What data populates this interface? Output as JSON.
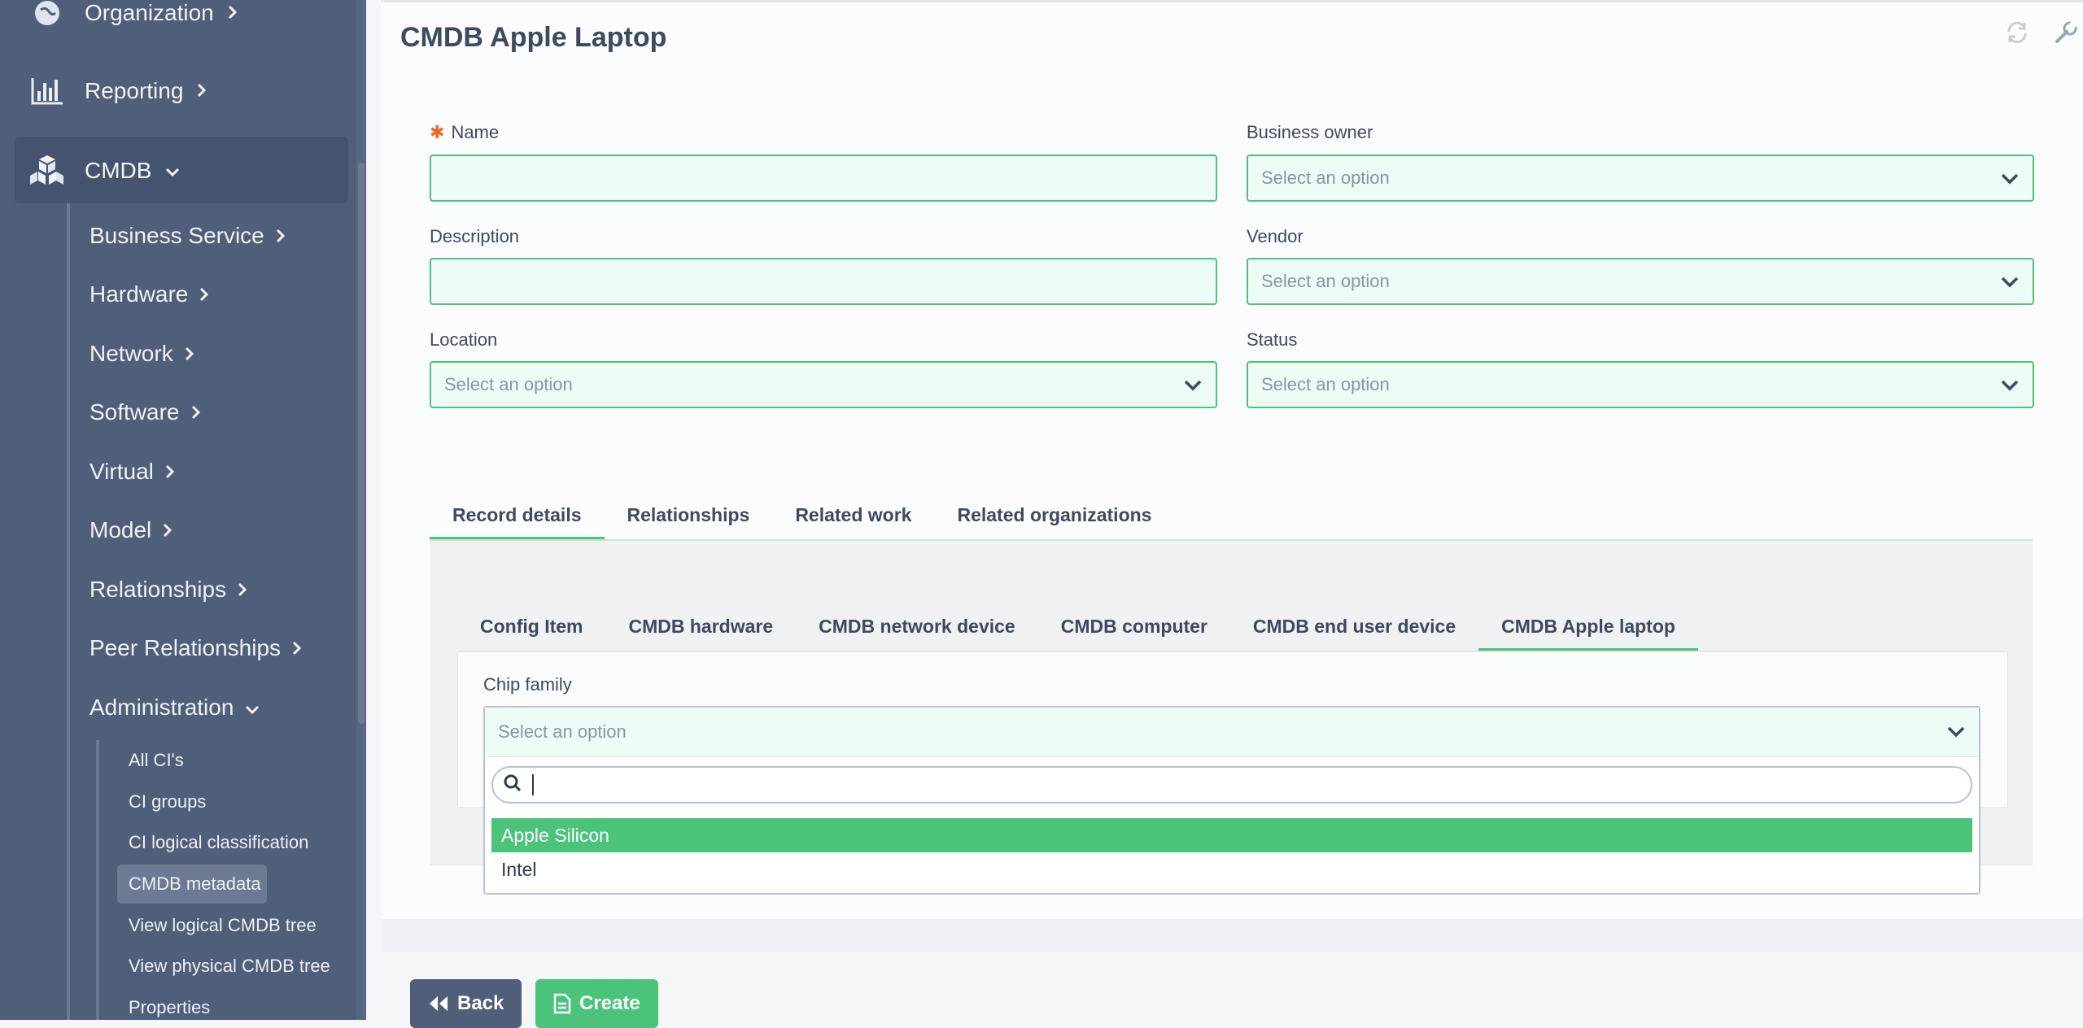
{
  "page": {
    "title": "CMDB Apple Laptop"
  },
  "sidebar": {
    "top": [
      {
        "label": "Organization",
        "icon": "globe-icon"
      },
      {
        "label": "Reporting",
        "icon": "bar-chart-icon"
      },
      {
        "label": "CMDB",
        "icon": "cubes-icon"
      }
    ],
    "cmdb_items": [
      "Business Service",
      "Hardware",
      "Network",
      "Software",
      "Virtual",
      "Model",
      "Relationships",
      "Peer Relationships",
      "Administration"
    ],
    "admin_items": [
      "All CI's",
      "CI groups",
      "CI logical classification",
      "CMDB metadata",
      "View logical CMDB tree",
      "View physical CMDB tree",
      "Properties"
    ],
    "active_admin_item": "CMDB metadata"
  },
  "form": {
    "name_label": "Name",
    "description_label": "Description",
    "location_label": "Location",
    "business_owner_label": "Business owner",
    "vendor_label": "Vendor",
    "status_label": "Status",
    "placeholder": "Select an option"
  },
  "tabs": [
    "Record details",
    "Relationships",
    "Related work",
    "Related organizations"
  ],
  "active_tab": "Record details",
  "subtabs": [
    "Config Item",
    "CMDB hardware",
    "CMDB network device",
    "CMDB computer",
    "CMDB end user device",
    "CMDB Apple laptop"
  ],
  "active_subtab": "CMDB Apple laptop",
  "chip": {
    "label": "Chip family",
    "placeholder": "Select an option",
    "search_value": "",
    "options": [
      "Apple Silicon",
      "Intel"
    ],
    "highlighted": "Apple Silicon"
  },
  "buttons": {
    "back": "Back",
    "create": "Create"
  },
  "colors": {
    "sidebar": "#4f5f7a",
    "accent_green": "#4cc37b",
    "back_button": "#4f5f7a"
  }
}
